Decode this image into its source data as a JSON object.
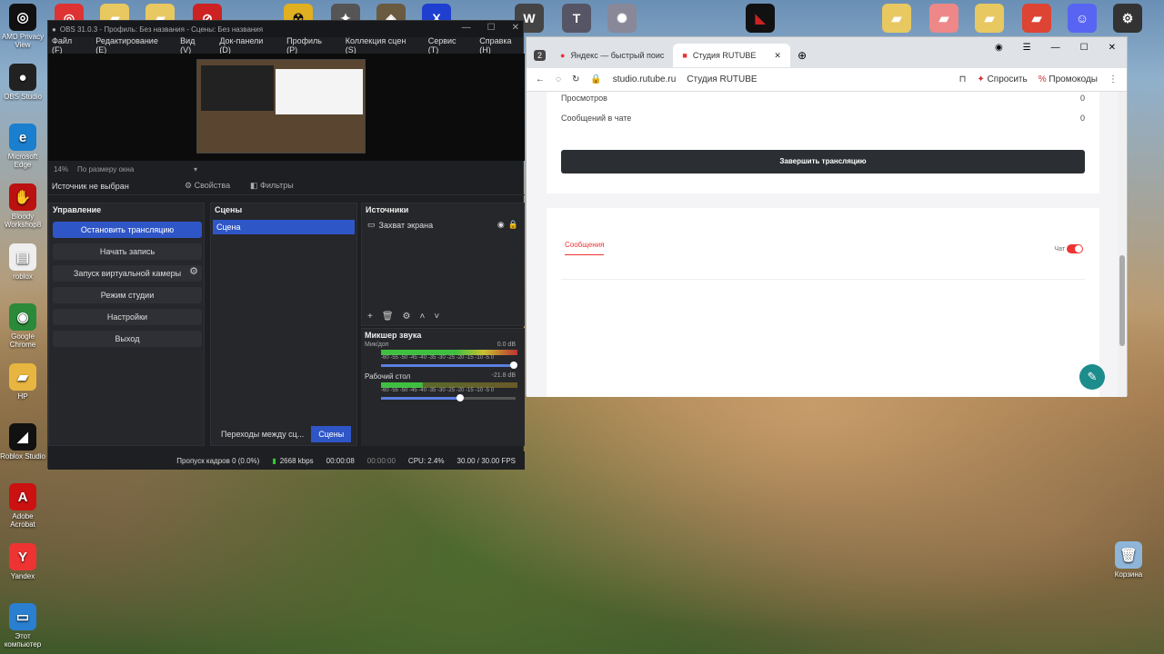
{
  "desktop": {
    "icons": [
      {
        "label": "AMD Privacy View",
        "glyph": "◎",
        "color": "#111"
      },
      {
        "label": "OBS Studio",
        "glyph": "●",
        "color": "#222"
      },
      {
        "label": "Microsoft Edge",
        "glyph": "e",
        "color": "#1a7fcf"
      },
      {
        "label": "Bloody Workshop8",
        "glyph": "✋",
        "color": "#b11"
      },
      {
        "label": "roblox",
        "glyph": "▤",
        "color": "#eee"
      },
      {
        "label": "Google Chrome",
        "glyph": "◉",
        "color": "#2a8a3a"
      },
      {
        "label": "HP",
        "glyph": "▰",
        "color": "#e8b640"
      },
      {
        "label": "Roblox Studio",
        "glyph": "◢",
        "color": "#111"
      },
      {
        "label": "Adobe Acrobat",
        "glyph": "A",
        "color": "#c11"
      },
      {
        "label": "Yandex",
        "glyph": "Y",
        "color": "#e33"
      },
      {
        "label": "Этот компьютер",
        "glyph": "▭",
        "color": "#2a7fd0"
      }
    ],
    "recycle": "Корзина"
  },
  "obs": {
    "title": "OBS 31.0.3 - Профиль: Без названия - Сцены: Без названия",
    "menu": [
      "Файл (F)",
      "Редактирование (E)",
      "Вид (V)",
      "Док-панели (D)",
      "Профиль (P)",
      "Коллекция сцен (S)",
      "Сервис (T)",
      "Справка (H)"
    ],
    "zoom": "14%",
    "zoom_mode": "По размеру окна",
    "no_source": "Источник не выбран",
    "properties": "Свойства",
    "filters": "Фильтры",
    "controls_title": "Управление",
    "controls": [
      "Остановить трансляцию",
      "Начать запись",
      "Запуск виртуальной камеры",
      "Режим студии",
      "Настройки",
      "Выход"
    ],
    "scenes_title": "Сцены",
    "scene": "Сцена",
    "sources_title": "Источники",
    "source": "Захват экрана",
    "mixer_title": "Микшер звука",
    "mic_label": "Мик/доп",
    "mic_db": "0.0 dB",
    "desk_label": "Рабочий стол",
    "desk_db": "-21.8 dB",
    "meter_scale": "-60 -55 -50 -45 -40 -35 -30 -25 -20 -15 -10 -5 0",
    "tab_transitions": "Переходы между сц...",
    "tab_scenes": "Сцены",
    "status": {
      "dropped": "Пропуск кадров 0 (0.0%)",
      "kbps": "2668 kbps",
      "live": "00:00:08",
      "rec": "00:00:00",
      "cpu": "CPU: 2.4%",
      "fps": "30.00 / 30.00 FPS"
    }
  },
  "browser": {
    "tab_count": "2",
    "tab1": "Яндекс — быстрый поис",
    "tab2": "Студия RUTUBE",
    "url": "studio.rutube.ru",
    "page_title": "Студия RUTUBE",
    "ask": "Спросить",
    "promo": "Промокоды",
    "views_label": "Просмотров",
    "views": "0",
    "chat_msgs_label": "Сообщений в чате",
    "chat_msgs": "0",
    "end_button": "Завершить трансляцию",
    "messages_tab": "Сообщения",
    "chat_toggle": "Чат"
  }
}
